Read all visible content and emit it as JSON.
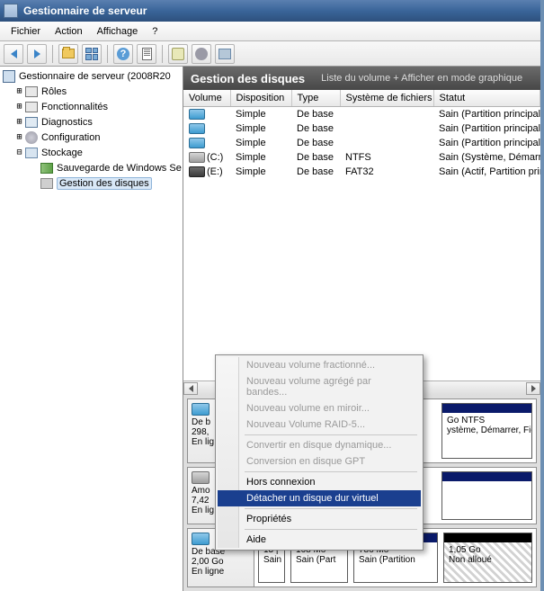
{
  "window": {
    "title": "Gestionnaire de serveur"
  },
  "menubar": [
    "Fichier",
    "Action",
    "Affichage",
    "?"
  ],
  "tree": {
    "root": "Gestionnaire de serveur (2008R20",
    "roles": "Rôles",
    "features": "Fonctionnalités",
    "diagnostics": "Diagnostics",
    "configuration": "Configuration",
    "storage": "Stockage",
    "backup": "Sauvegarde de Windows Se",
    "diskmgmt": "Gestion des disques"
  },
  "rightHeader": {
    "title": "Gestion des disques",
    "subtitle": "Liste du volume + Afficher en mode graphique"
  },
  "columns": {
    "volume": "Volume",
    "disposition": "Disposition",
    "type": "Type",
    "fs": "Système de fichiers",
    "status": "Statut"
  },
  "volumes": [
    {
      "iconClass": "",
      "name": "",
      "disposition": "Simple",
      "type": "De base",
      "fs": "",
      "status": "Sain (Partition principale)"
    },
    {
      "iconClass": "",
      "name": "",
      "disposition": "Simple",
      "type": "De base",
      "fs": "",
      "status": "Sain (Partition principale)"
    },
    {
      "iconClass": "",
      "name": "",
      "disposition": "Simple",
      "type": "De base",
      "fs": "",
      "status": "Sain (Partition principale)"
    },
    {
      "iconClass": "grey",
      "name": "(C:)",
      "disposition": "Simple",
      "type": "De base",
      "fs": "NTFS",
      "status": "Sain (Système, Démarrer, F"
    },
    {
      "iconClass": "dark",
      "name": "(E:)",
      "disposition": "Simple",
      "type": "De base",
      "fs": "FAT32",
      "status": "Sain (Actif, Partition princip"
    }
  ],
  "disk0": {
    "type": "De b",
    "size": "298,",
    "online": "En lig",
    "part1_line1": "Go NTFS",
    "part1_line2": "ystème, Démarrer, Fichier d'é"
  },
  "disk1": {
    "type": "Amo",
    "size": "7,42",
    "online": "En lig"
  },
  "disk2": {
    "type": "De base",
    "size": "2,00 Go",
    "online": "En ligne",
    "parts": [
      {
        "l1": "13 |",
        "l2": "Sain"
      },
      {
        "l1": "168 Mo",
        "l2": "Sain (Part"
      },
      {
        "l1": "786 Mo",
        "l2": "Sain (Partition"
      },
      {
        "l1": "1,05 Go",
        "l2": "Non alloué"
      }
    ]
  },
  "ctx": {
    "new_spanned": "Nouveau volume fractionné...",
    "new_striped": "Nouveau volume agrégé par bandes...",
    "new_mirror": "Nouveau volume en miroir...",
    "new_raid5": "Nouveau Volume RAID-5...",
    "convert_dyn": "Convertir en disque dynamique...",
    "convert_gpt": "Conversion en disque GPT",
    "offline": "Hors connexion",
    "detach_vhd": "Détacher un disque dur virtuel",
    "properties": "Propriétés",
    "help": "Aide"
  }
}
